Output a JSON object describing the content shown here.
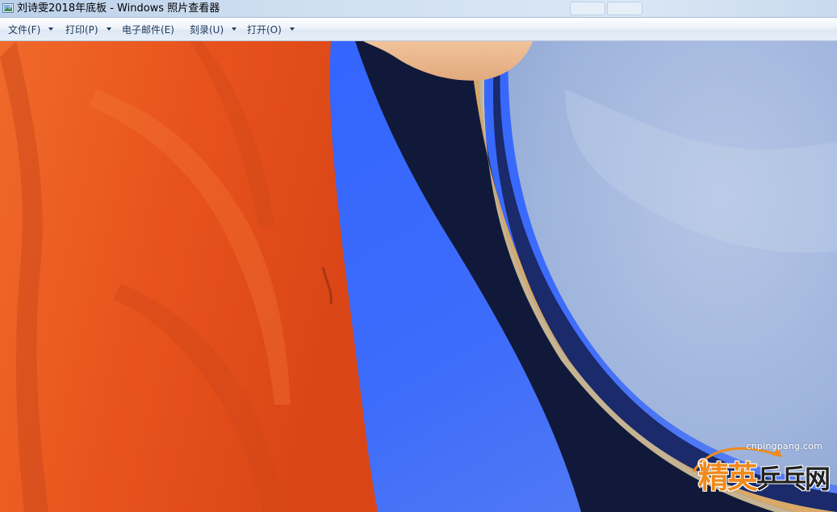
{
  "window": {
    "title": "刘诗雯2018年底板 - Windows 照片查看器",
    "app_icon": "photo-viewer-icon"
  },
  "menu": {
    "items": [
      {
        "label": "文件(F)",
        "has_dropdown": true
      },
      {
        "label": "打印(P)",
        "has_dropdown": true
      },
      {
        "label": "电子邮件(E)",
        "has_dropdown": false
      },
      {
        "label": "刻录(U)",
        "has_dropdown": true
      },
      {
        "label": "打开(O)",
        "has_dropdown": true
      }
    ]
  },
  "photo": {
    "colors": {
      "orange": "#e8531d",
      "blue": "#3a6bff",
      "light_blue": "#9fb6dc",
      "gold": "#d9a968",
      "dark_navy": "#0f1a3a"
    }
  },
  "watermark": {
    "url": "cnpingpang.com",
    "text_accent": "精英",
    "text_dark": "乒乓网"
  }
}
